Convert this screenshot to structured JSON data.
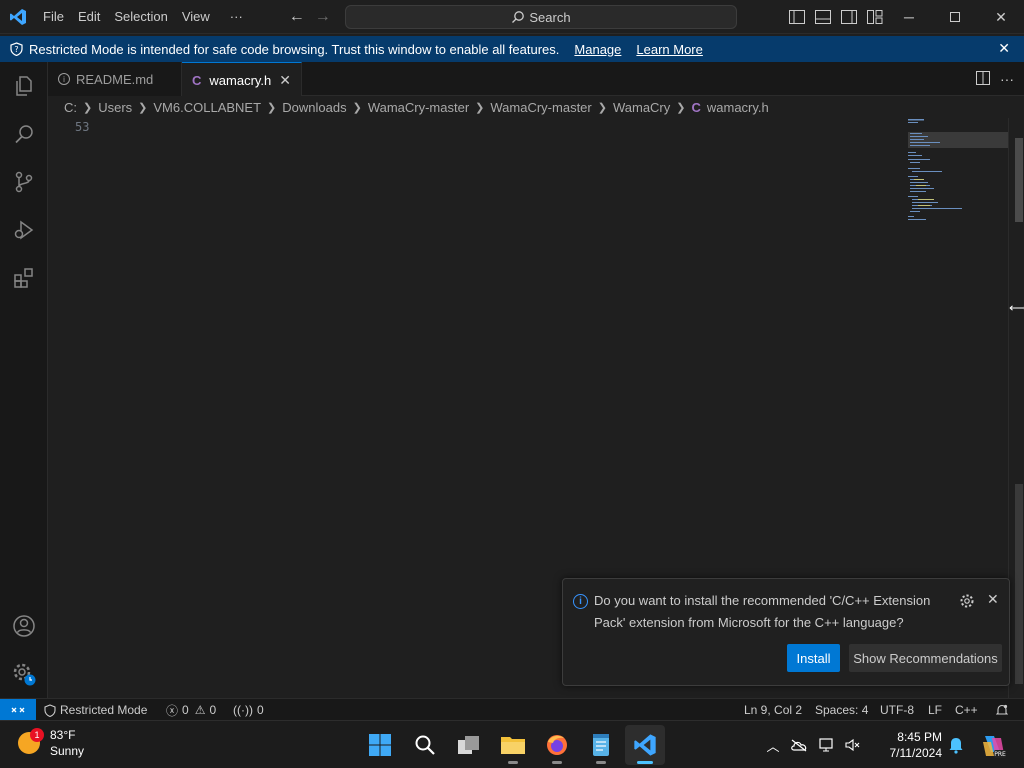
{
  "titlebar": {
    "menu": [
      "File",
      "Edit",
      "Selection",
      "View"
    ],
    "more": "···",
    "search_placeholder": "Search"
  },
  "banner": {
    "text": "Restricted Mode is intended for safe code browsing. Trust this window to enable all features.",
    "manage": "Manage",
    "learn_more": "Learn More"
  },
  "tabs": [
    {
      "label": "README.md",
      "active": false
    },
    {
      "label": "wamacry.h",
      "active": true
    }
  ],
  "breadcrumb": [
    "C:",
    "Users",
    "VM6.COLLABNET",
    "Downloads",
    "WamaCry-master",
    "WamaCry-master",
    "WamaCry",
    "wamacry.h"
  ],
  "editor": {
    "line_number": "53"
  },
  "notification": {
    "message": "Do you want to install the recommended 'C/C++ Extension Pack' extension from Microsoft for the C++ language?",
    "install_label": "Install",
    "show_label": "Show Recommendations"
  },
  "statusbar": {
    "restricted_mode": "Restricted Mode",
    "errors": "0",
    "warnings": "0",
    "ports": "0",
    "position": "Ln 9, Col 2",
    "spaces": "Spaces: 4",
    "encoding": "UTF-8",
    "eol": "LF",
    "language": "C++"
  },
  "taskbar": {
    "weather_temp": "83°F",
    "weather_desc": "Sunny",
    "weather_badge": "1",
    "time": "8:45 PM",
    "date": "7/11/2024"
  },
  "colors": {
    "accent": "#0078d4",
    "banner": "#063b6c",
    "editor_bg": "#1f1f1f"
  }
}
